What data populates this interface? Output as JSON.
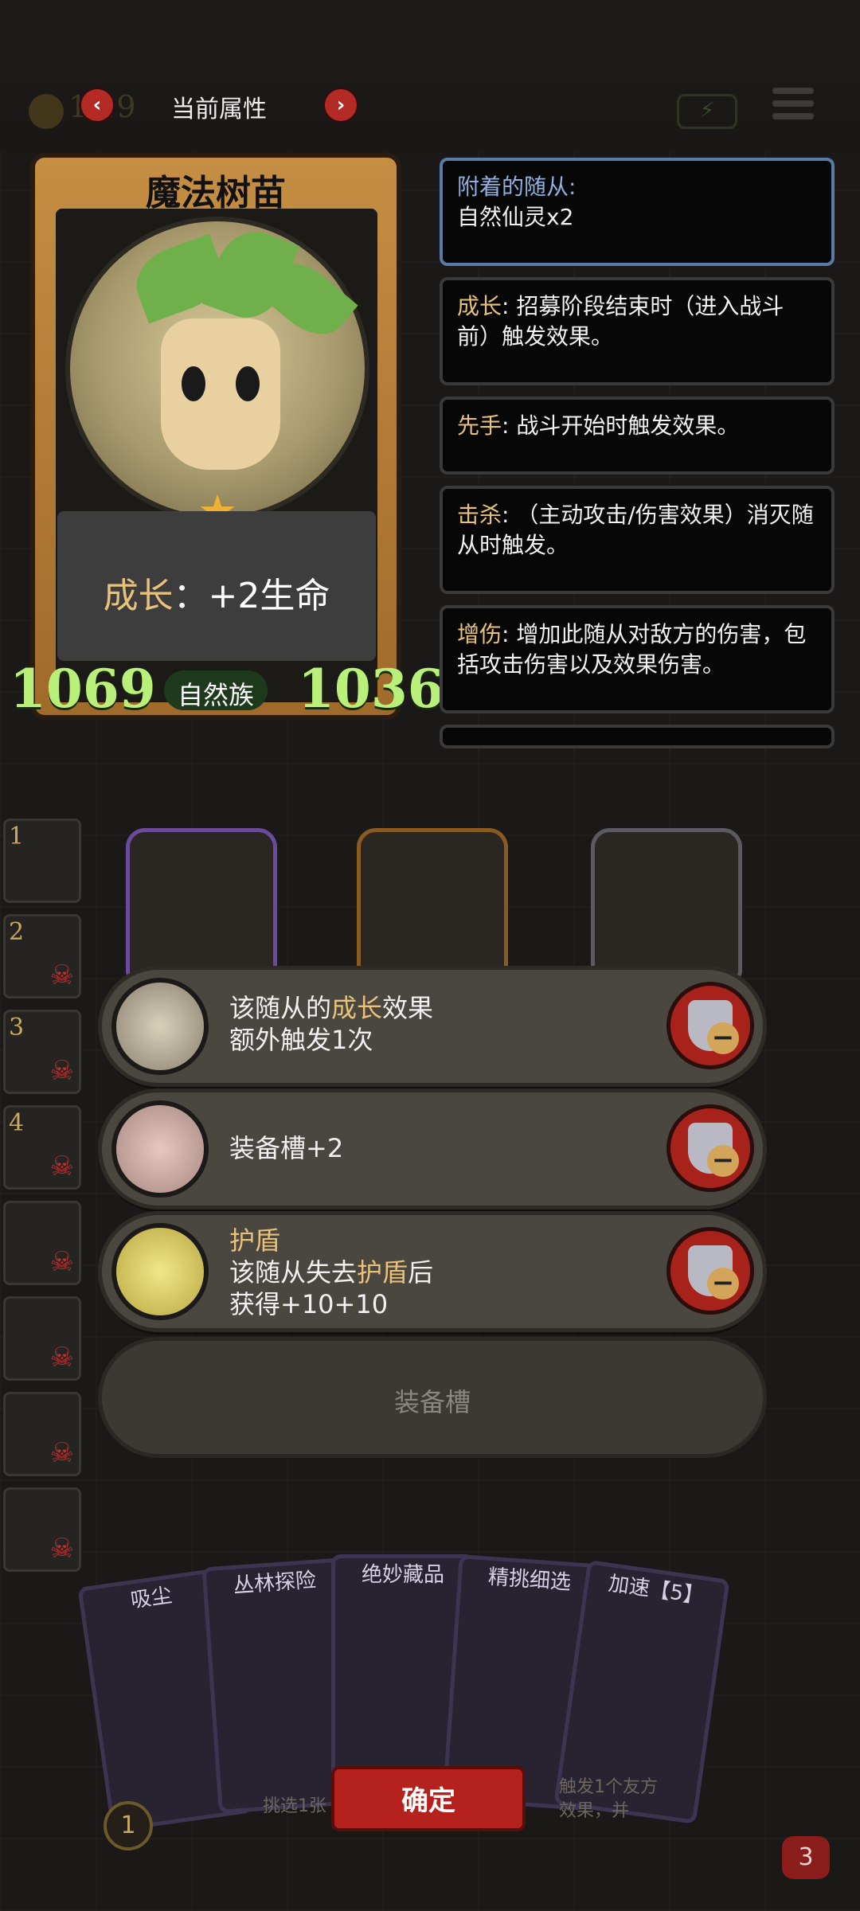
{
  "top_bar": {
    "title": "当前属性",
    "prev_arrow": "‹",
    "next_arrow": "›",
    "gold_partial": "1 19"
  },
  "hero_card": {
    "name": "魔法树苗",
    "effect_keyword": "成长",
    "effect_value": "：+2生命",
    "attack": "1069",
    "health": "1036",
    "tribe": "自然族"
  },
  "info_panels": [
    {
      "keyword": "附着的随从:",
      "text": "自然仙灵x2"
    },
    {
      "keyword": "成长",
      "text": ": 招募阶段结束时（进入战斗前）触发效果。"
    },
    {
      "keyword": "先手",
      "text": ": 战斗开始时触发效果。"
    },
    {
      "keyword": "击杀",
      "text": ": （主动攻击/伤害效果）消灭随从时触发。"
    },
    {
      "keyword": "增伤",
      "text": ": 增加此随从对敌方的伤害，包括攻击伤害以及效果伤害。"
    }
  ],
  "side_slots": [
    "1",
    "2",
    "3",
    "4",
    "",
    "",
    "",
    ""
  ],
  "equipment": [
    {
      "line1_a": "该随从的",
      "line1_kw": "成长",
      "line1_b": "效果",
      "line2": "额外触发1次"
    },
    {
      "line1": "装备槽+2"
    },
    {
      "title": "护盾",
      "line2_a": "该随从失去",
      "line2_kw": "护盾",
      "line2_b": "后",
      "line3": "获得+10+10"
    }
  ],
  "empty_slot_label": "装备槽",
  "hand_cards": [
    "吸尘",
    "丛林探险",
    "绝妙藏品",
    "精挑细选",
    "加速【5】"
  ],
  "hand_hints": {
    "left": "挑选1张",
    "right": "触发1个友方",
    "right2": "效果，并"
  },
  "confirm_label": "确定",
  "level": "1",
  "lives": "3"
}
